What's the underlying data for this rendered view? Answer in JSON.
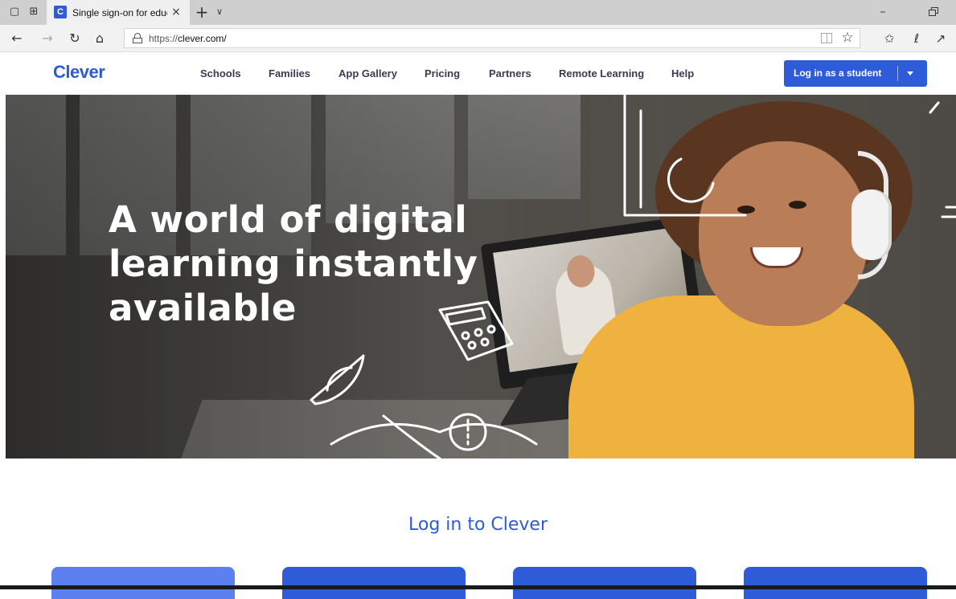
{
  "browser": {
    "tab_title": "Single sign-on for educ",
    "tab_favicon_letter": "C",
    "close_glyph": "×",
    "newtab_glyph": "+",
    "tabmenu_glyph": "∨",
    "minimize_glyph": "–",
    "url_scheme": "https://",
    "url_host": "clever.com/",
    "icons": {
      "tab_set_aside": "tabs-aside-icon",
      "tab_preview": "tabs-preview-icon",
      "back": "back-arrow-icon",
      "forward": "forward-arrow-icon",
      "refresh": "refresh-icon",
      "home": "home-icon",
      "reading_view": "reading-view-icon",
      "favorite": "star-icon",
      "favorites_hub": "favorites-hub-icon",
      "notes": "pen-icon",
      "share": "share-icon"
    }
  },
  "site": {
    "logo": "Clever",
    "nav": [
      "Schools",
      "Families",
      "App Gallery",
      "Pricing",
      "Partners",
      "Remote Learning",
      "Help"
    ],
    "login_button": "Log in as a student",
    "colors": {
      "brand": "#2e5bd8",
      "nav_text": "#3a3a55",
      "card_light": "#5c80f0"
    }
  },
  "hero": {
    "heading_lines": [
      "A world of digital",
      "learning instantly",
      "available"
    ]
  },
  "login_section": {
    "heading": "Log in to Clever"
  }
}
